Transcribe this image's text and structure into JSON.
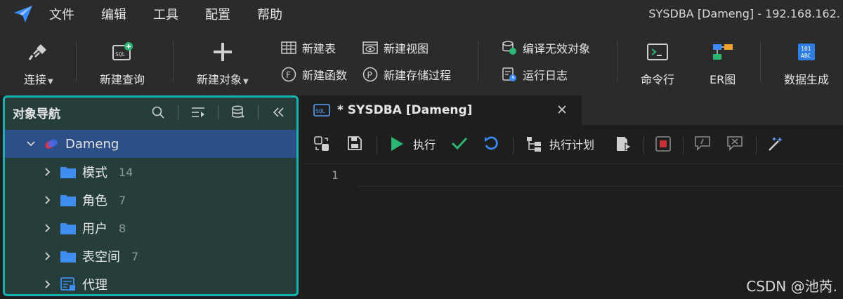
{
  "menu": {
    "items": [
      "文件",
      "编辑",
      "工具",
      "配置",
      "帮助"
    ],
    "window_title": "SYSDBA [Dameng]  - 192.168.162."
  },
  "toolbar": {
    "connect_label": "连接",
    "new_query_label": "新建查询",
    "new_object_label": "新建对象",
    "new_table_label": "新建表",
    "new_view_label": "新建视图",
    "new_function_label": "新建函数",
    "new_procedure_label": "新建存储过程",
    "compile_invalid_label": "编译无效对象",
    "run_log_label": "运行日志",
    "command_line_label": "命令行",
    "er_diagram_label": "ER图",
    "data_gen_label": "数据生成"
  },
  "nav": {
    "title": "对象导航",
    "root": "Dameng",
    "items": [
      {
        "label": "模式",
        "count": "14"
      },
      {
        "label": "角色",
        "count": "7"
      },
      {
        "label": "用户",
        "count": "8"
      },
      {
        "label": "表空间",
        "count": "7"
      },
      {
        "label": "代理",
        "count": ""
      }
    ]
  },
  "editor": {
    "tab_label": "* SYSDBA [Dameng]",
    "execute_label": "执行",
    "plan_label": "执行计划",
    "line_number": "1"
  },
  "watermark": "CSDN @池芮."
}
